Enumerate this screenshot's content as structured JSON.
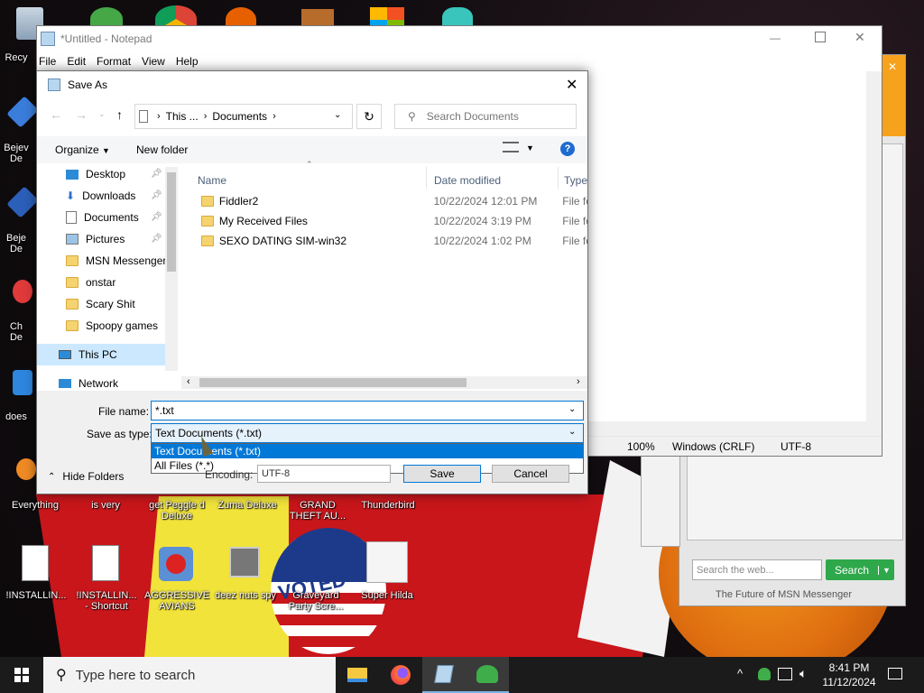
{
  "desktop": {
    "left_icons": [
      {
        "label": "Recy"
      },
      {
        "label": "Bejev\nDe"
      },
      {
        "label": "Beje\nDe"
      },
      {
        "label": "Ch\nDe"
      },
      {
        "label": "does"
      },
      {
        "label": "Everything"
      }
    ],
    "row1": [
      "is very",
      "get Peggle d\nDeluxe",
      "Zuma Deluxe",
      "GRAND\nTHEFT AU...",
      "Thunderbird"
    ],
    "row2": [
      "!INSTALLIN...",
      "!INSTALLIN...\n- Shortcut",
      "AGGRESSIVE\nAVIANS",
      "deez nuts spy",
      "Graveyard\nParty Scre...",
      "Super Hilda"
    ],
    "badge_text": "VOTED"
  },
  "notepad": {
    "title": "*Untitled - Notepad",
    "menu": [
      "File",
      "Edit",
      "Format",
      "View",
      "Help"
    ],
    "status": {
      "zoom": "100%",
      "line_ending": "Windows (CRLF)",
      "encoding": "UTF-8"
    }
  },
  "dialog": {
    "title": "Save As",
    "breadcrumb": [
      "This ...",
      "Documents"
    ],
    "search_placeholder": "Search Documents",
    "organize": "Organize",
    "new_folder": "New folder",
    "nav_items": [
      {
        "label": "Desktop",
        "pinned": true
      },
      {
        "label": "Downloads",
        "pinned": true
      },
      {
        "label": "Documents",
        "pinned": true
      },
      {
        "label": "Pictures",
        "pinned": true
      },
      {
        "label": "MSN Messenger",
        "pinned": false
      },
      {
        "label": "onstar",
        "pinned": false
      },
      {
        "label": "Scary Shit",
        "pinned": false
      },
      {
        "label": "Spoopy games",
        "pinned": false
      }
    ],
    "this_pc": "This PC",
    "network": "Network",
    "columns": {
      "name": "Name",
      "date": "Date modified",
      "type": "Type"
    },
    "files": [
      {
        "name": "Fiddler2",
        "date": "10/22/2024 12:01 PM",
        "type": "File fo"
      },
      {
        "name": "My Received Files",
        "date": "10/22/2024 3:19 PM",
        "type": "File fo"
      },
      {
        "name": "SEXO DATING SIM-win32",
        "date": "10/22/2024 1:02 PM",
        "type": "File fo"
      }
    ],
    "file_name_label": "File name:",
    "file_name_value": "*.txt",
    "save_type_label": "Save as type:",
    "save_type_value": "Text Documents (*.txt)",
    "dropdown_options": [
      "Text Documents (*.txt)",
      "All Files  (*.*)"
    ],
    "encoding_label": "Encoding:",
    "encoding_value": "UTF-8",
    "hide_folders": "Hide Folders",
    "save": "Save",
    "cancel": "Cancel"
  },
  "msn": {
    "search_placeholder": "Search the web...",
    "search_button": "Search",
    "footer": "The Future of MSN Messenger"
  },
  "taskbar": {
    "search_placeholder": "Type here to search",
    "time": "8:41 PM",
    "date": "11/12/2024"
  },
  "colors": {
    "accent": "#0078d7",
    "selection": "#cce8ff",
    "taskbar": "#1b1b1b"
  }
}
